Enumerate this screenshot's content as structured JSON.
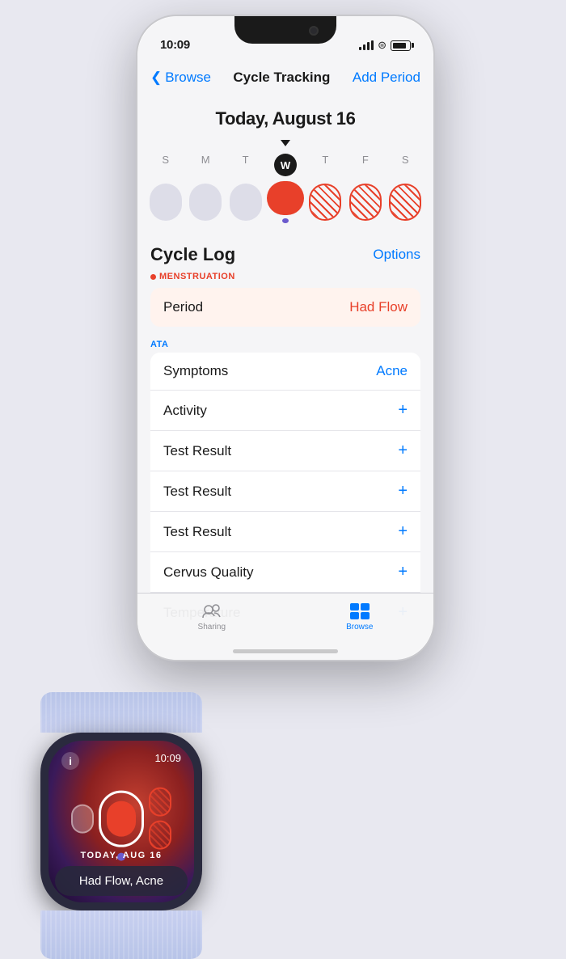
{
  "status_bar": {
    "time": "10:09"
  },
  "nav": {
    "back_label": "Browse",
    "title": "Cycle Tracking",
    "action_label": "Add Period"
  },
  "date_header": "Today, August 16",
  "calendar": {
    "day_labels": [
      "S",
      "M",
      "T",
      "W",
      "T",
      "F",
      "S"
    ],
    "today_index": 3
  },
  "cycle_log": {
    "title": "Cycle Log",
    "options_label": "Options",
    "section_label": "MENSTRUATION",
    "period_label": "Period",
    "period_value": "Had Flow",
    "health_data_label": "ATA",
    "rows": [
      {
        "label": "oms",
        "value": "Acne",
        "has_plus": false
      },
      {
        "label": "ivity",
        "value": "",
        "has_plus": true
      },
      {
        "label": "t Result",
        "value": "",
        "has_plus": true
      },
      {
        "label": "Test Result",
        "value": "",
        "has_plus": true
      },
      {
        "label": "est Result",
        "value": "",
        "has_plus": true
      },
      {
        "label": "us Quality",
        "value": "",
        "has_plus": true
      },
      {
        "label": "emperature",
        "value": "",
        "has_plus": true
      }
    ]
  },
  "tab_bar": {
    "sharing_label": "Sharing",
    "browse_label": "Browse"
  },
  "watch": {
    "time": "10:09",
    "info_btn": "i",
    "date": "TODAY, AUG 16",
    "summary": "Had Flow, Acne"
  }
}
